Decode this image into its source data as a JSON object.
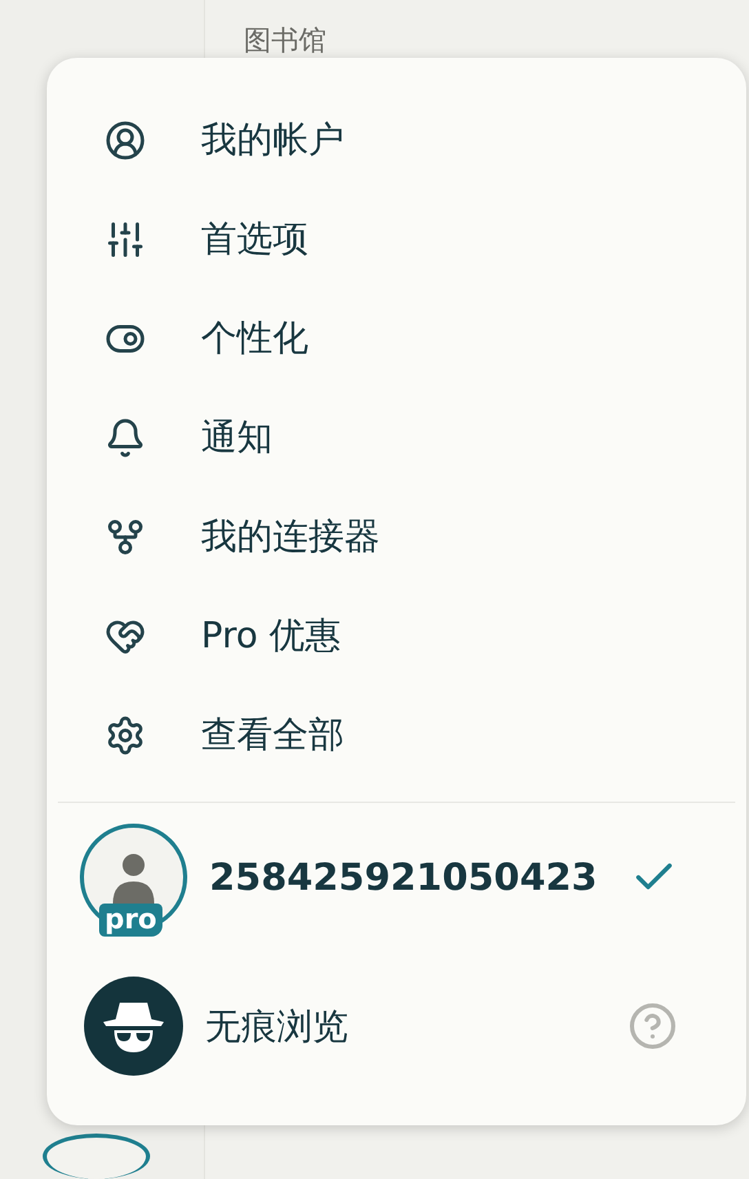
{
  "background": {
    "heading": "图书馆"
  },
  "menu": {
    "items": [
      {
        "label": "我的帐户"
      },
      {
        "label": "首选项"
      },
      {
        "label": "个性化"
      },
      {
        "label": "通知"
      },
      {
        "label": "我的连接器"
      },
      {
        "label": "Pro 优惠"
      },
      {
        "label": "查看全部"
      }
    ],
    "accounts": [
      {
        "kind": "profile",
        "name": "258425921050423",
        "badge": "pro",
        "selected": true
      },
      {
        "kind": "incognito",
        "name": "无痕浏览"
      }
    ]
  }
}
